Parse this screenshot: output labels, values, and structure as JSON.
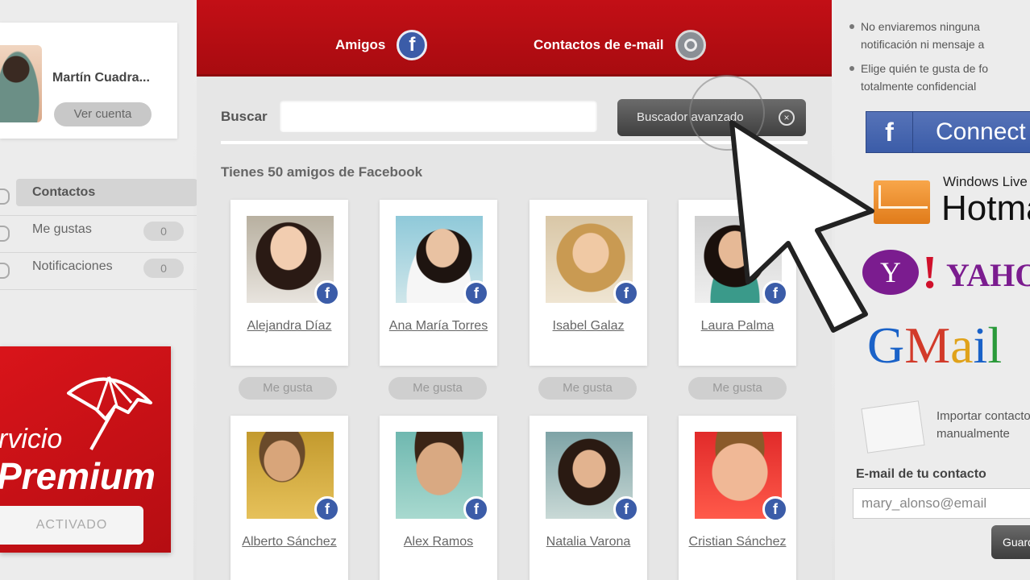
{
  "profile": {
    "name": "Martín Cuadra...",
    "view_label": "Ver cuenta"
  },
  "nav": {
    "items": [
      {
        "label": "Contactos",
        "count": null,
        "active": true
      },
      {
        "label": "Me gustas",
        "count": "0"
      },
      {
        "label": "Notificaciones",
        "count": "0"
      }
    ]
  },
  "premium": {
    "line1": "rvicio",
    "line2": "Premium",
    "button": "ACTIVADO",
    "color": "#c30f16"
  },
  "tabs": {
    "friends": "Amigos",
    "email_contacts": "Contactos de e-mail",
    "friends_icon": "facebook-icon",
    "email_icon": "mail-icon"
  },
  "search": {
    "label": "Buscar",
    "value": "",
    "advanced": "Buscador avanzado",
    "close_glyph": "×"
  },
  "friends_count_text": "Tienes 50 amigos de Facebook",
  "friends": [
    {
      "name": "Alejandra Díaz",
      "like": "Me gusta"
    },
    {
      "name": "Ana María Torres",
      "like": "Me gusta"
    },
    {
      "name": "Isabel Galaz",
      "like": "Me gusta"
    },
    {
      "name": "Laura Palma",
      "like": "Me gusta"
    },
    {
      "name": "Alberto Sánchez"
    },
    {
      "name": "Alex Ramos"
    },
    {
      "name": "Natalia Varona"
    },
    {
      "name": "Cristian Sánchez"
    }
  ],
  "right": {
    "bullets": [
      "No enviaremos ninguna notificación ni mensaje a",
      "Elige quién te gusta de fo totalmente confidencial"
    ],
    "facebook_connect": "Connect",
    "hotmail_small": "Windows Live",
    "hotmail_big": "Hotmail",
    "yahoo": "YAHOO",
    "gmail": "GMail",
    "import_text_1": "Importar contactos",
    "import_text_2": "manualmente",
    "email_label": "E-mail de tu contacto",
    "email_value": "mary_alonso@email",
    "save_label": "Guardar"
  },
  "colors": {
    "brand_red": "#c30f16",
    "facebook_blue": "#3b5ca8",
    "dark_button": "#4a4a4a"
  }
}
